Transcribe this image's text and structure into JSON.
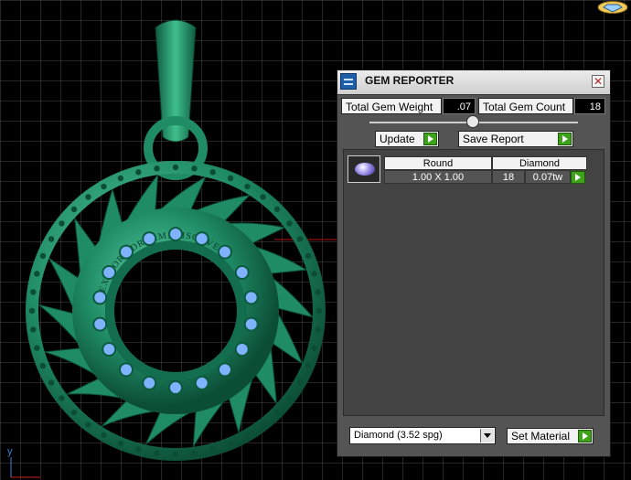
{
  "panel": {
    "title": "GEM REPORTER",
    "total_weight_label": "Total Gem Weight",
    "total_weight_value": ".07",
    "total_count_label": "Total Gem Count",
    "total_count_value": "18",
    "update_label": "Update",
    "save_report_label": "Save Report",
    "table": {
      "headers": [
        "Round",
        "Diamond"
      ],
      "rows": [
        {
          "size": "1.00 X 1.00",
          "count": "18",
          "weight": "0.07tw"
        }
      ]
    },
    "material_select_value": "Diamond      (3.52 spg)",
    "set_material_label": "Set Material"
  },
  "viewport": {
    "axis_label": "y",
    "model_color": "#1f8c66",
    "gem_color": "#7fb2ff",
    "engraving_text": "EXPLORE DREAM. DISCOVER"
  },
  "colors": {
    "accent_green": "#3ea31a",
    "panel_bg": "#545454"
  }
}
